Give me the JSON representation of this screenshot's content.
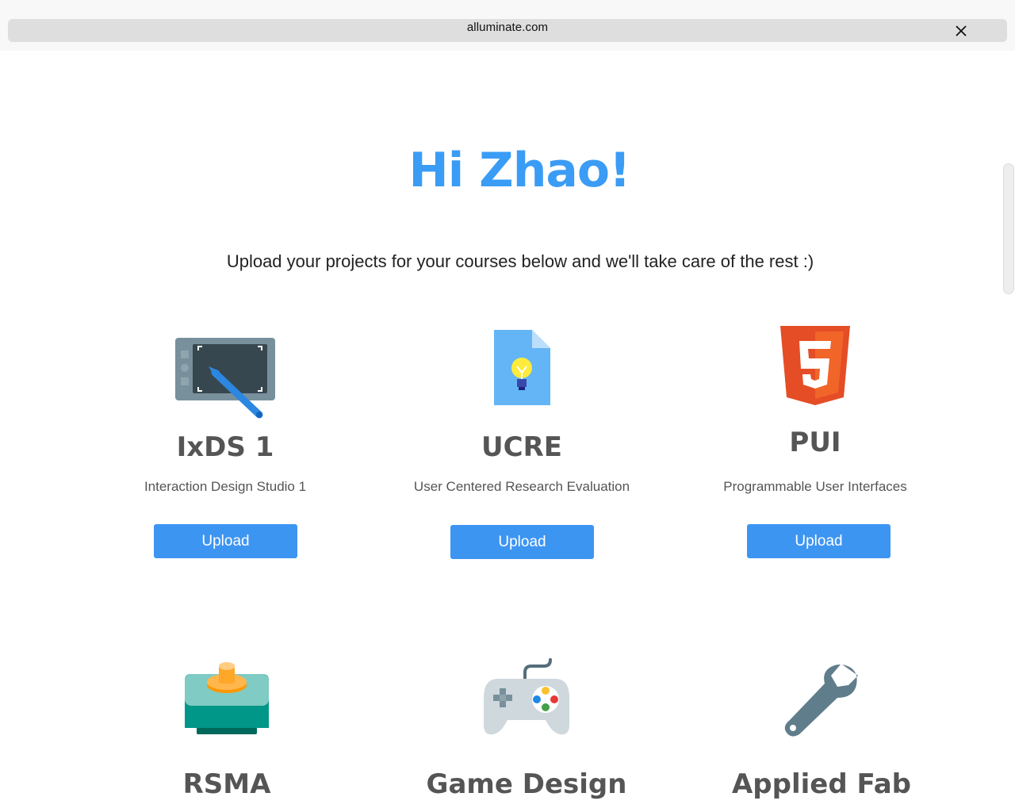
{
  "browser": {
    "url": "alluminate.com"
  },
  "page": {
    "greeting": "Hi Zhao!",
    "subtitle": "Upload your projects for your courses below and we'll take care of the rest :)"
  },
  "courses": [
    {
      "title": "IxDS 1",
      "description": "Interaction Design Studio 1",
      "button": "Upload",
      "icon": "drawing-tablet-icon"
    },
    {
      "title": "UCRE",
      "description": "User Centered Research Evaluation",
      "button": "Upload",
      "icon": "idea-document-icon"
    },
    {
      "title": "PUI",
      "description": "Programmable User Interfaces",
      "button": "Upload",
      "icon": "html5-icon"
    },
    {
      "title": "RSMA",
      "description": "",
      "button": "",
      "icon": "joystick-icon"
    },
    {
      "title": "Game Design",
      "description": "",
      "button": "",
      "icon": "gamepad-icon"
    },
    {
      "title": "Applied Fab",
      "description": "",
      "button": "",
      "icon": "wrench-icon"
    }
  ],
  "colors": {
    "accent": "#3a9cf5",
    "button": "#3d95f2",
    "text_dark": "#555555"
  }
}
